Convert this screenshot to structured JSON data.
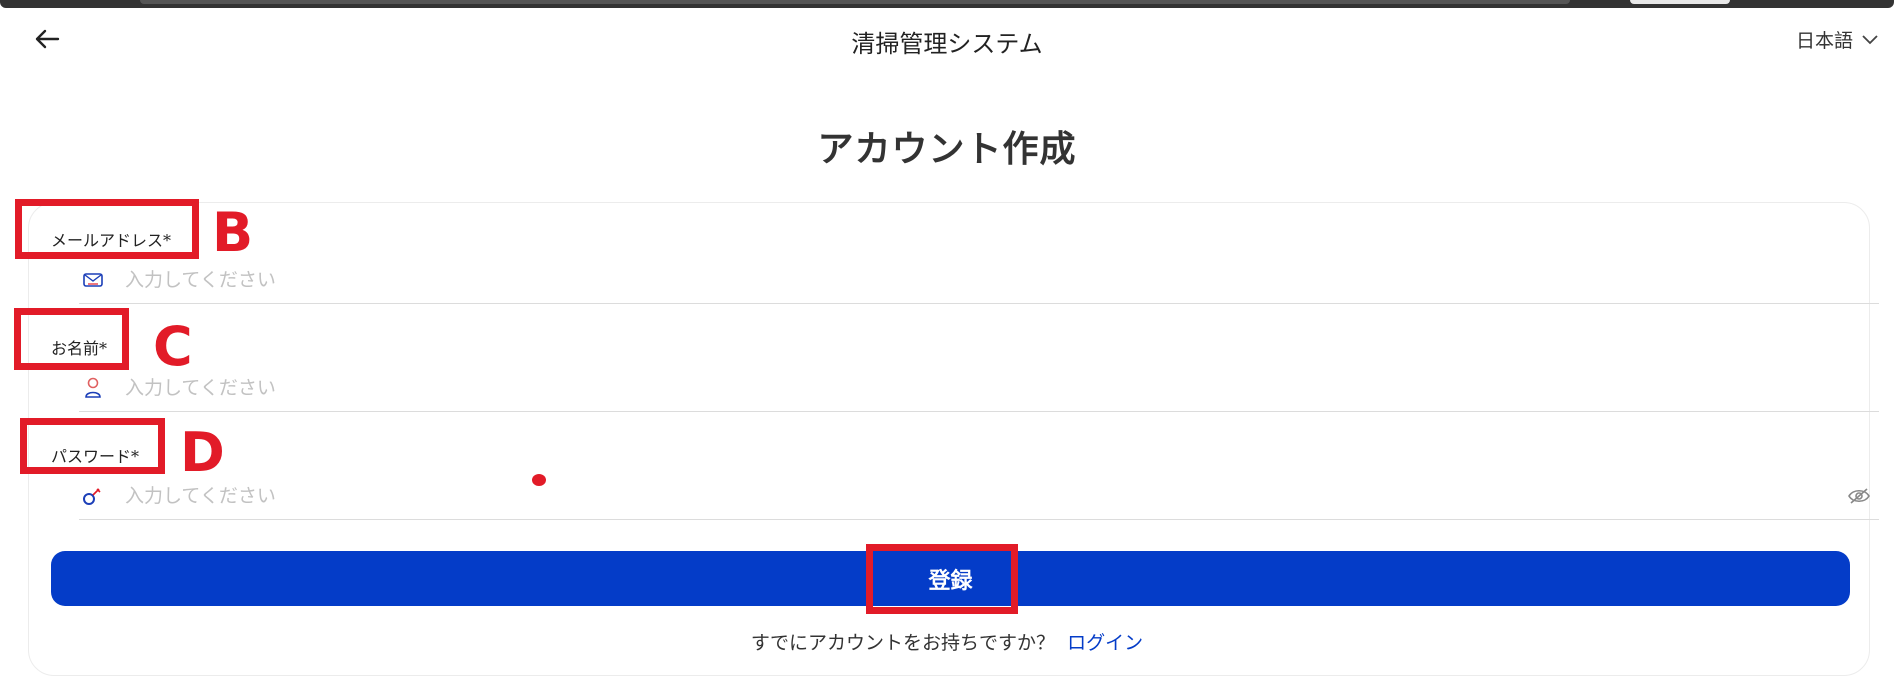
{
  "header": {
    "back_icon": "arrow-left-icon",
    "title": "清掃管理システム",
    "language": "日本語",
    "language_icon": "chevron-down-icon"
  },
  "heading": "アカウント作成",
  "form": {
    "email": {
      "label": "メールアドレス*",
      "placeholder": "入力してください",
      "icon": "mail-icon",
      "value": ""
    },
    "name": {
      "label": "お名前*",
      "placeholder": "入力してください",
      "icon": "user-icon",
      "value": ""
    },
    "password": {
      "label": "パスワード*",
      "placeholder": "入力してください",
      "icon": "key-icon",
      "toggle_icon": "eye-off-icon",
      "value": ""
    },
    "submit_label": "登録"
  },
  "footer": {
    "prompt": "すでにアカウントをお持ちですか？",
    "login_link": "ログイン"
  },
  "annotations": {
    "color": "#e21b28",
    "letters": [
      "B",
      "C",
      "D"
    ]
  },
  "colors": {
    "accent": "#043cc8",
    "annotation": "#e21b28"
  }
}
